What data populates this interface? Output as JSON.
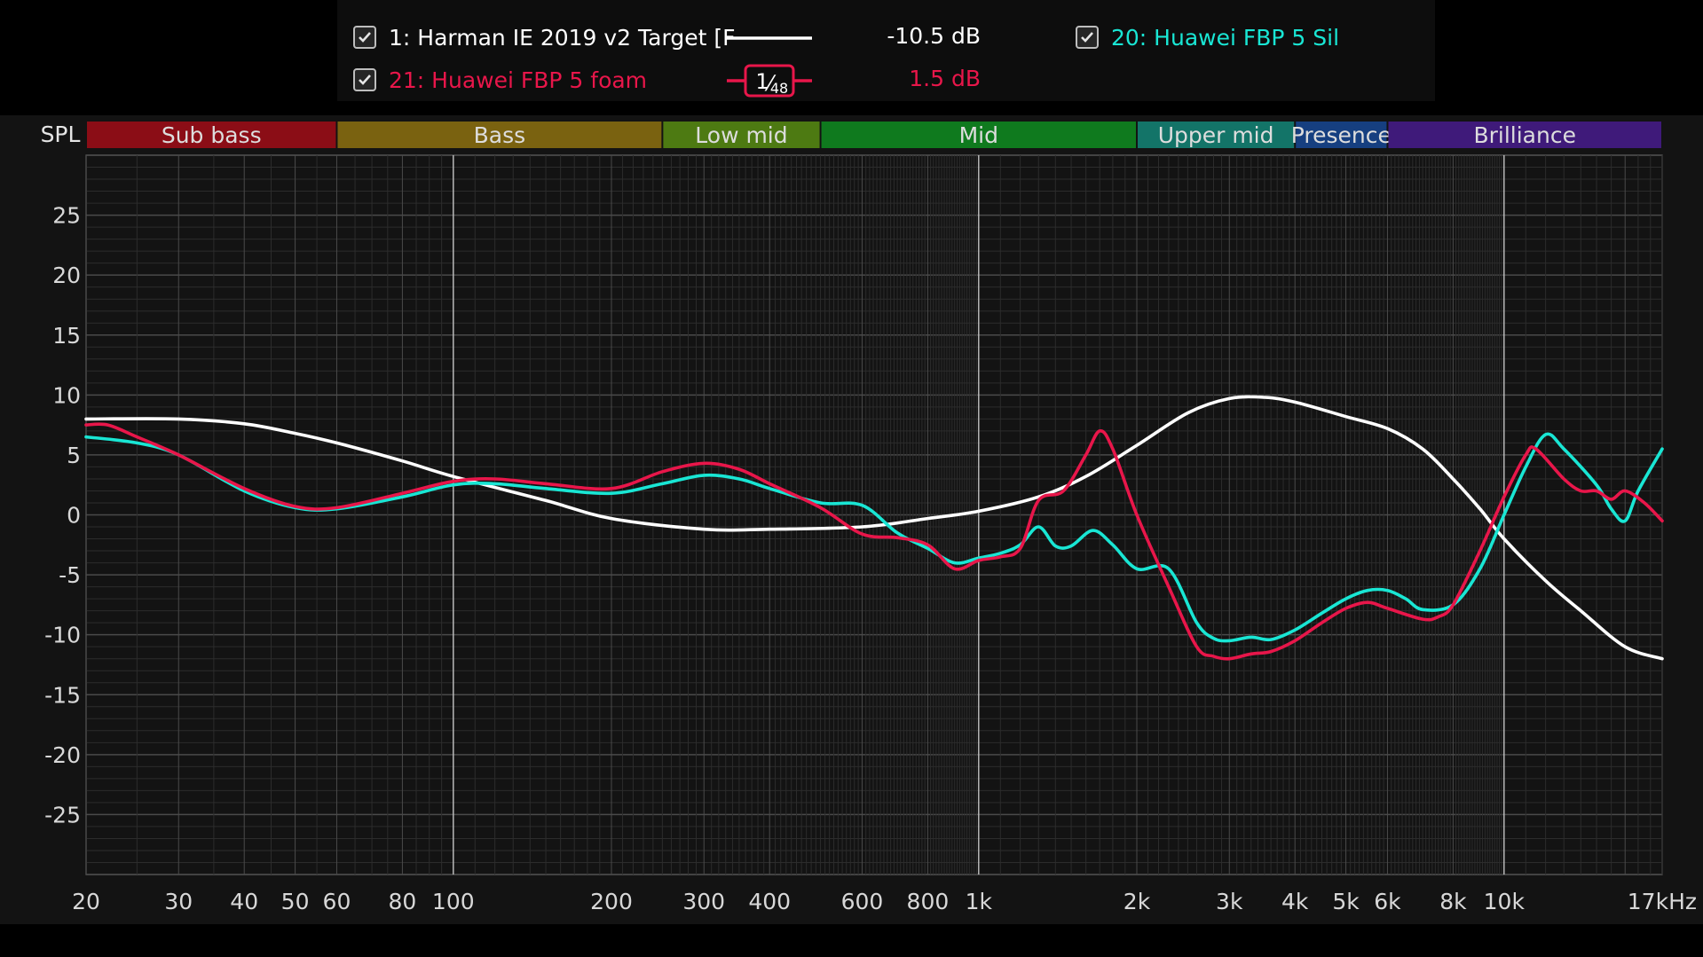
{
  "legend": {
    "items": [
      {
        "label": "1: Harman IE 2019 v2 Target [F",
        "value": "-10.5 dB",
        "color": "#ffffff",
        "checked": true
      },
      {
        "label": "20: Huawei FBP 5 Sil",
        "value": "",
        "color": "#19e6d4",
        "checked": true
      },
      {
        "label": "21: Huawei FBP 5 foam",
        "value": "1.5 dB",
        "color": "#e8164a",
        "checked": true
      }
    ],
    "smoothing_num": "1",
    "smoothing_den": "48"
  },
  "colors": {
    "background": "#131313",
    "grid_major": "#4a4a4a",
    "grid_minor": "#2c2c2c",
    "target": "#ffffff",
    "sil": "#19e6d4",
    "foam": "#e8164a"
  },
  "chart_data": {
    "type": "line",
    "ylabel": "SPL",
    "x_scale": "log",
    "xlim": [
      20,
      20000
    ],
    "ylim": [
      -30,
      30
    ],
    "x_ticks": [
      {
        "v": 20,
        "label": "20"
      },
      {
        "v": 30,
        "label": "30"
      },
      {
        "v": 40,
        "label": "40"
      },
      {
        "v": 50,
        "label": "50"
      },
      {
        "v": 60,
        "label": "60"
      },
      {
        "v": 80,
        "label": "80"
      },
      {
        "v": 100,
        "label": "100"
      },
      {
        "v": 200,
        "label": "200"
      },
      {
        "v": 300,
        "label": "300"
      },
      {
        "v": 400,
        "label": "400"
      },
      {
        "v": 600,
        "label": "600"
      },
      {
        "v": 800,
        "label": "800"
      },
      {
        "v": 1000,
        "label": "1k"
      },
      {
        "v": 2000,
        "label": "2k"
      },
      {
        "v": 3000,
        "label": "3k"
      },
      {
        "v": 4000,
        "label": "4k"
      },
      {
        "v": 5000,
        "label": "5k"
      },
      {
        "v": 6000,
        "label": "6k"
      },
      {
        "v": 8000,
        "label": "8k"
      },
      {
        "v": 10000,
        "label": "10k"
      },
      {
        "v": 17000,
        "label": "17kHz"
      }
    ],
    "y_ticks": [
      25,
      20,
      15,
      10,
      5,
      0,
      -5,
      -10,
      -15,
      -20,
      -25
    ],
    "bands": [
      {
        "label": "Sub bass",
        "from": 20,
        "to": 60,
        "color": "#8b0d16"
      },
      {
        "label": "Bass",
        "from": 60,
        "to": 250,
        "color": "#7a6210"
      },
      {
        "label": "Low mid",
        "from": 250,
        "to": 500,
        "color": "#4d7a12"
      },
      {
        "label": "Mid",
        "from": 500,
        "to": 2000,
        "color": "#0f7a1e"
      },
      {
        "label": "Upper mid",
        "from": 2000,
        "to": 4000,
        "color": "#137468"
      },
      {
        "label": "Presence",
        "from": 4000,
        "to": 6000,
        "color": "#163f80"
      },
      {
        "label": "Brilliance",
        "from": 6000,
        "to": 20000,
        "color": "#3f1a7a"
      }
    ],
    "series": [
      {
        "name": "1: Harman IE 2019 v2 Target [F",
        "color": "#ffffff",
        "points": [
          [
            20,
            8
          ],
          [
            30,
            8
          ],
          [
            40,
            7.6
          ],
          [
            50,
            6.8
          ],
          [
            60,
            6
          ],
          [
            80,
            4.5
          ],
          [
            100,
            3.2
          ],
          [
            150,
            1.2
          ],
          [
            200,
            -0.3
          ],
          [
            300,
            -1.2
          ],
          [
            400,
            -1.2
          ],
          [
            600,
            -1
          ],
          [
            800,
            -0.3
          ],
          [
            1000,
            0.3
          ],
          [
            1300,
            1.5
          ],
          [
            1600,
            3.2
          ],
          [
            2000,
            5.8
          ],
          [
            2500,
            8.5
          ],
          [
            3000,
            9.7
          ],
          [
            3500,
            9.8
          ],
          [
            4000,
            9.4
          ],
          [
            5000,
            8.2
          ],
          [
            6000,
            7.2
          ],
          [
            7000,
            5.5
          ],
          [
            8000,
            3
          ],
          [
            9000,
            0.5
          ],
          [
            10000,
            -2
          ],
          [
            12000,
            -5.5
          ],
          [
            14000,
            -8
          ],
          [
            17000,
            -11
          ],
          [
            20000,
            -12
          ]
        ]
      },
      {
        "name": "20: Huawei FBP 5 Sil",
        "color": "#19e6d4",
        "points": [
          [
            20,
            6.5
          ],
          [
            25,
            6
          ],
          [
            30,
            5
          ],
          [
            40,
            2
          ],
          [
            50,
            0.6
          ],
          [
            60,
            0.5
          ],
          [
            80,
            1.5
          ],
          [
            100,
            2.5
          ],
          [
            120,
            2.6
          ],
          [
            150,
            2.2
          ],
          [
            200,
            1.8
          ],
          [
            250,
            2.6
          ],
          [
            300,
            3.3
          ],
          [
            350,
            3
          ],
          [
            400,
            2.2
          ],
          [
            500,
            1
          ],
          [
            600,
            0.8
          ],
          [
            700,
            -1.5
          ],
          [
            800,
            -2.8
          ],
          [
            900,
            -4
          ],
          [
            1000,
            -3.6
          ],
          [
            1100,
            -3.2
          ],
          [
            1200,
            -2.5
          ],
          [
            1300,
            -1
          ],
          [
            1400,
            -2.6
          ],
          [
            1500,
            -2.6
          ],
          [
            1650,
            -1.3
          ],
          [
            1800,
            -2.5
          ],
          [
            2000,
            -4.5
          ],
          [
            2300,
            -4.5
          ],
          [
            2600,
            -9
          ],
          [
            2800,
            -10.3
          ],
          [
            3000,
            -10.5
          ],
          [
            3300,
            -10.2
          ],
          [
            3600,
            -10.4
          ],
          [
            4000,
            -9.6
          ],
          [
            4500,
            -8.2
          ],
          [
            5000,
            -7
          ],
          [
            5500,
            -6.3
          ],
          [
            6000,
            -6.3
          ],
          [
            6500,
            -7
          ],
          [
            7000,
            -7.9
          ],
          [
            8000,
            -7.5
          ],
          [
            9000,
            -4.5
          ],
          [
            10000,
            0
          ],
          [
            11000,
            4
          ],
          [
            12000,
            6.7
          ],
          [
            13000,
            5.5
          ],
          [
            15000,
            2.5
          ],
          [
            16000,
            0.5
          ],
          [
            17000,
            -0.5
          ],
          [
            18000,
            2
          ],
          [
            20000,
            5.5
          ]
        ]
      },
      {
        "name": "21: Huawei FBP 5 foam",
        "color": "#e8164a",
        "points": [
          [
            20,
            7.5
          ],
          [
            22,
            7.5
          ],
          [
            25,
            6.5
          ],
          [
            30,
            5
          ],
          [
            40,
            2.2
          ],
          [
            50,
            0.7
          ],
          [
            60,
            0.6
          ],
          [
            80,
            1.8
          ],
          [
            100,
            2.8
          ],
          [
            120,
            3
          ],
          [
            150,
            2.6
          ],
          [
            200,
            2.2
          ],
          [
            250,
            3.6
          ],
          [
            300,
            4.3
          ],
          [
            350,
            3.8
          ],
          [
            400,
            2.6
          ],
          [
            500,
            0.6
          ],
          [
            600,
            -1.6
          ],
          [
            700,
            -1.9
          ],
          [
            800,
            -2.5
          ],
          [
            900,
            -4.5
          ],
          [
            1000,
            -3.8
          ],
          [
            1100,
            -3.5
          ],
          [
            1200,
            -2.8
          ],
          [
            1300,
            1.2
          ],
          [
            1450,
            2
          ],
          [
            1600,
            5
          ],
          [
            1700,
            7
          ],
          [
            1800,
            5.5
          ],
          [
            2000,
            0
          ],
          [
            2300,
            -6
          ],
          [
            2600,
            -11
          ],
          [
            2800,
            -11.8
          ],
          [
            3000,
            -12
          ],
          [
            3300,
            -11.6
          ],
          [
            3600,
            -11.4
          ],
          [
            4000,
            -10.5
          ],
          [
            4500,
            -9
          ],
          [
            5000,
            -7.8
          ],
          [
            5500,
            -7.3
          ],
          [
            6000,
            -7.8
          ],
          [
            7000,
            -8.7
          ],
          [
            7500,
            -8.5
          ],
          [
            8000,
            -7.5
          ],
          [
            9000,
            -3
          ],
          [
            10000,
            1.5
          ],
          [
            11000,
            5
          ],
          [
            11500,
            5.5
          ],
          [
            13000,
            3
          ],
          [
            14000,
            2
          ],
          [
            15000,
            2
          ],
          [
            16000,
            1.3
          ],
          [
            17000,
            2
          ],
          [
            18500,
            1
          ],
          [
            20000,
            -0.5
          ]
        ]
      }
    ]
  }
}
